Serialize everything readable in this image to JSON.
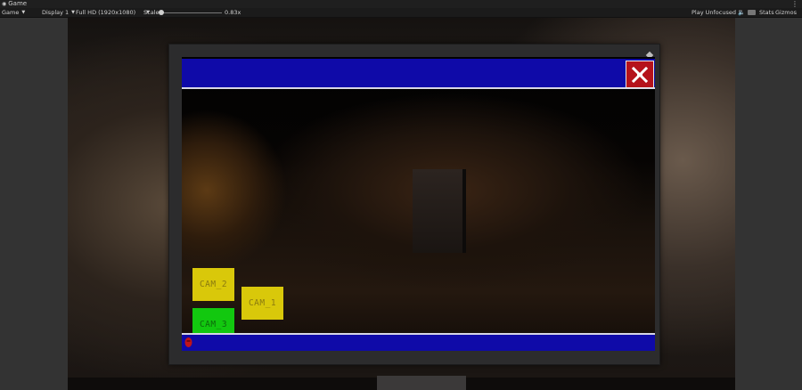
{
  "tab": {
    "title": "Game",
    "icon": "gamepad-icon"
  },
  "toolbar": {
    "view_mode": "Game",
    "display": "Display 1",
    "resolution": "Full HD (1920x1080)",
    "scale_label": "Scale",
    "scale_value": "0.83x",
    "play_mode": "Play Unfocused",
    "stats_label": "Stats",
    "gizmos_label": "Gizmos"
  },
  "game_ui": {
    "close_icon": "close-x-icon",
    "cameras": [
      {
        "label": "CAM_2",
        "color": "#d9c80a"
      },
      {
        "label": "CAM_1",
        "color": "#d9c80a"
      },
      {
        "label": "CAM_3",
        "color": "#12c80f"
      }
    ],
    "bar_color": "#0f0aa8",
    "close_color": "#b5121b"
  }
}
